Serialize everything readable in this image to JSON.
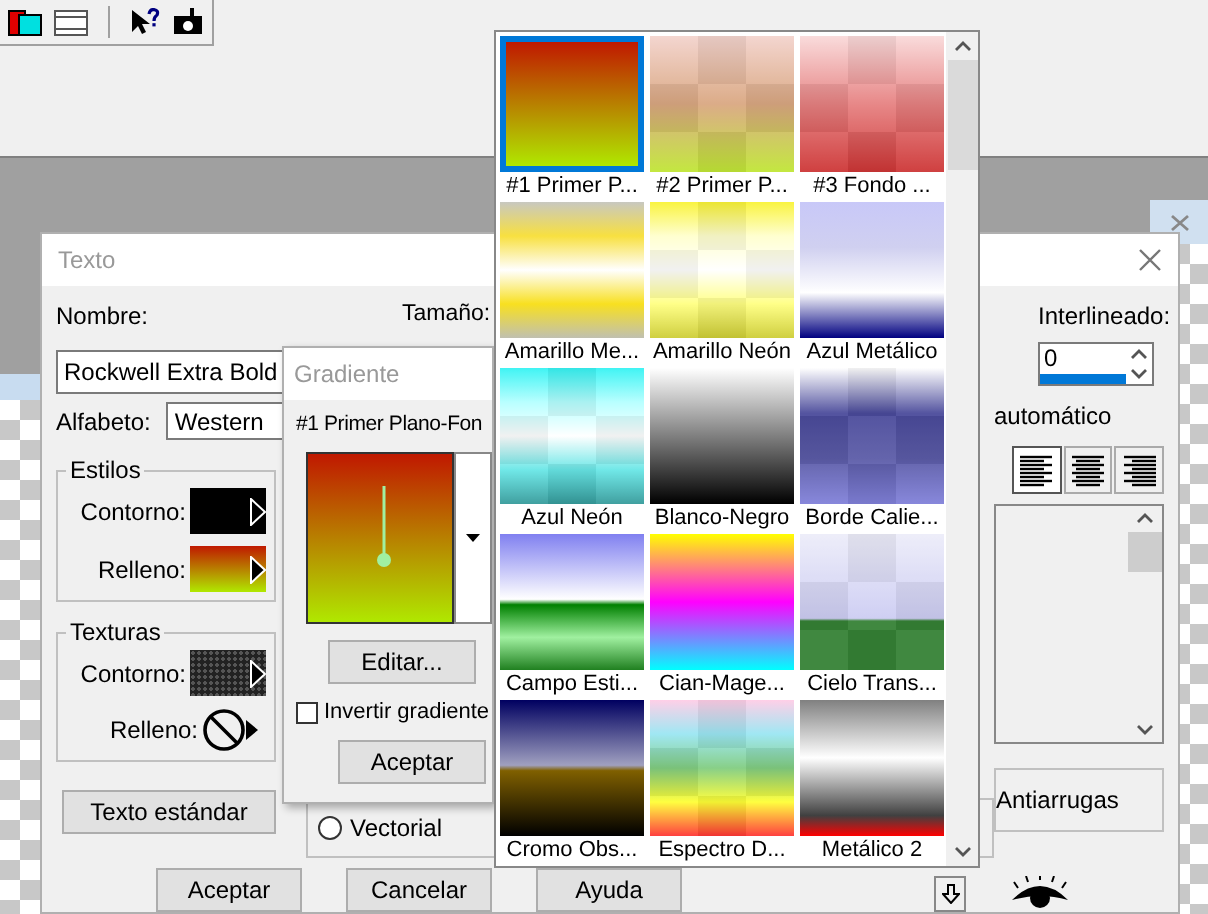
{
  "text_dialog": {
    "title": "Texto",
    "name_label": "Nombre:",
    "size_label": "Tamaño:",
    "font_field": {
      "value": "Rockwell Extra Bold"
    },
    "alphabet_label": "Alfabeto:",
    "alphabet_field": {
      "value": "Western"
    },
    "styles_group": {
      "title": "Estilos",
      "rows": [
        {
          "label": "Contorno:",
          "kind": "solid"
        },
        {
          "label": "Relleno:",
          "kind": "gradient"
        }
      ]
    },
    "textures_group": {
      "title": "Texturas",
      "rows": [
        {
          "label": "Contorno:",
          "kind": "texture"
        },
        {
          "label": "Relleno:",
          "kind": "none"
        }
      ]
    },
    "standard_text_button": "Texto estándar",
    "vectorial_radio": {
      "label": "Vectorial",
      "selected": false
    },
    "line_spacing_label": "Interlineado:",
    "line_spacing_field": {
      "value": "0"
    },
    "auto_label": "automático",
    "alignment_buttons": [
      {
        "kind": "left",
        "selected": true
      },
      {
        "kind": "center",
        "selected": false
      },
      {
        "kind": "right",
        "selected": false
      }
    ],
    "antialias_label": "Antiarrugas",
    "buttons": [
      "Aceptar",
      "Cancelar",
      "Ayuda"
    ]
  },
  "gradient_popup": {
    "title": "Gradiente",
    "current": "#1 Primer Plano-Fon",
    "edit_button": "Editar...",
    "invert_checkbox": {
      "label": "Invertir gradiente",
      "checked": false
    },
    "ok_button": "Aceptar"
  },
  "gradient_palette": {
    "items": [
      {
        "label": "#1 Primer P...",
        "selected": true
      },
      {
        "label": "#2 Primer P...",
        "selected": false
      },
      {
        "label": "#3 Fondo ...",
        "selected": false
      },
      {
        "label": "Amarillo Me...",
        "selected": false
      },
      {
        "label": "Amarillo Neón",
        "selected": false
      },
      {
        "label": "Azul Metálico",
        "selected": false
      },
      {
        "label": "Azul Neón",
        "selected": false
      },
      {
        "label": "Blanco-Negro",
        "selected": false
      },
      {
        "label": "Borde Calie...",
        "selected": false
      },
      {
        "label": "Campo Esti...",
        "selected": false
      },
      {
        "label": "Cian-Mage...",
        "selected": false
      },
      {
        "label": "Cielo Trans...",
        "selected": false
      },
      {
        "label": "Cromo Obs...",
        "selected": false
      },
      {
        "label": "Espectro D...",
        "selected": false
      },
      {
        "label": "Metálico 2",
        "selected": false
      }
    ]
  }
}
